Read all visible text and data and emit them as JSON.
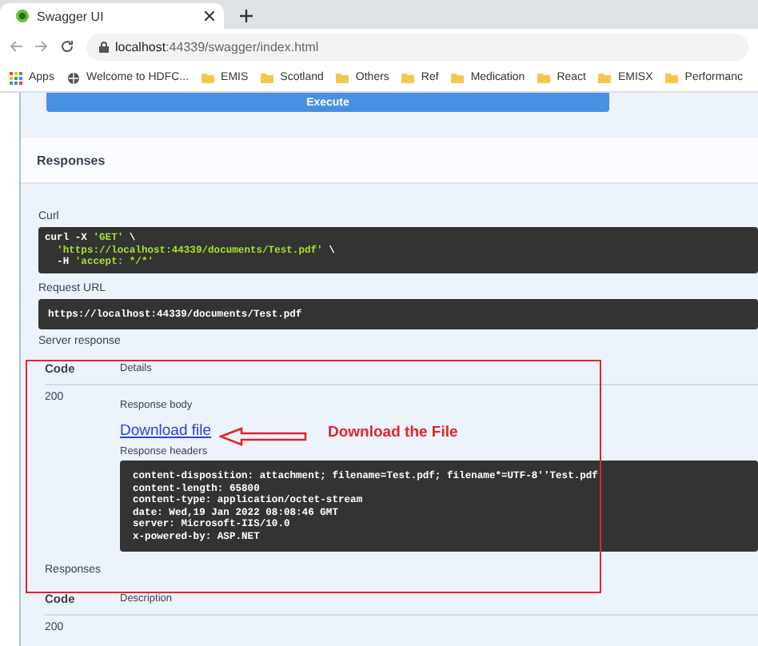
{
  "browser": {
    "tab": {
      "title": "Swagger UI"
    },
    "address": {
      "host": "localhost",
      "path": ":44339/swagger/index.html"
    },
    "bookmarks": [
      {
        "label": "Apps",
        "kind": "apps"
      },
      {
        "label": "Welcome to HDFC...",
        "kind": "site"
      },
      {
        "label": "EMIS",
        "kind": "folder"
      },
      {
        "label": "Scotland",
        "kind": "folder"
      },
      {
        "label": "Others",
        "kind": "folder"
      },
      {
        "label": "Ref",
        "kind": "folder"
      },
      {
        "label": "Medication",
        "kind": "folder"
      },
      {
        "label": "React",
        "kind": "folder"
      },
      {
        "label": "EMISX",
        "kind": "folder"
      },
      {
        "label": "Performanc",
        "kind": "folder"
      }
    ]
  },
  "execute_button": "Execute",
  "responses_title": "Responses",
  "curl": {
    "label": "Curl",
    "lines": [
      [
        {
          "text": "curl -X ",
          "kind": "plain"
        },
        {
          "text": "'GET'",
          "kind": "string"
        },
        {
          "text": " \\",
          "kind": "plain"
        }
      ],
      [
        {
          "text": "'https://localhost:44339/documents/Test.pdf'",
          "kind": "string"
        },
        {
          "text": " \\",
          "kind": "plain"
        }
      ],
      [
        {
          "text": "-H ",
          "kind": "plain"
        },
        {
          "text": "'accept: */*'",
          "kind": "string"
        }
      ]
    ]
  },
  "request_url": {
    "label": "Request URL",
    "value": "https://localhost:44339/documents/Test.pdf"
  },
  "server_response": {
    "label": "Server response",
    "columns": [
      "Code",
      "Details"
    ],
    "code": "200",
    "body_label": "Response body",
    "download_link": "Download file",
    "headers_label": "Response headers",
    "headers": [
      "content-disposition: attachment; filename=Test.pdf; filename*=UTF-8''Test.pdf",
      "content-length: 65800",
      "content-type: application/octet-stream",
      "date: Wed,19 Jan 2022 08:08:46 GMT",
      "server: Microsoft-IIS/10.0",
      "x-powered-by: ASP.NET"
    ]
  },
  "responses": {
    "label": "Responses",
    "columns": [
      "Code",
      "Description"
    ],
    "first_code": "200"
  },
  "annotation": {
    "text": "Download the File"
  }
}
